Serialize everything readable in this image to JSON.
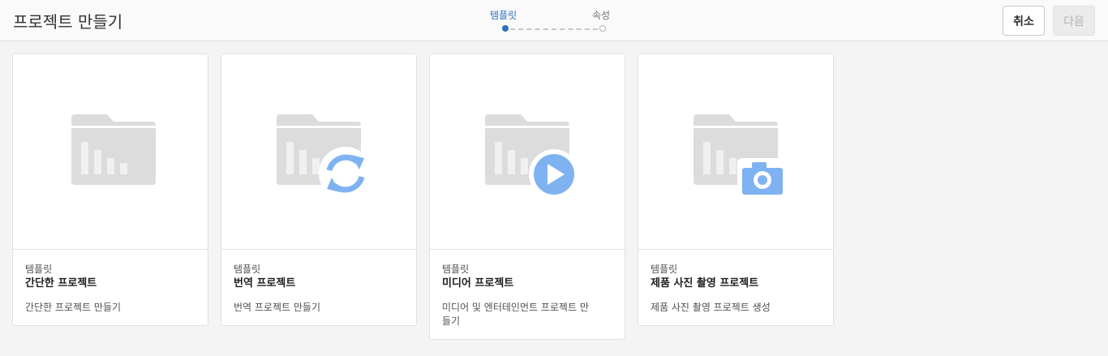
{
  "header": {
    "title": "프로젝트 만들기",
    "steps": [
      {
        "label": "템플릿",
        "active": true
      },
      {
        "label": "속성",
        "active": false
      }
    ],
    "cancel_label": "취소",
    "next_label": "다음"
  },
  "cards": [
    {
      "kicker": "템플릿",
      "title": "간단한 프로젝트",
      "description": "간단한 프로젝트 만들기",
      "badge_icon": "none"
    },
    {
      "kicker": "템플릿",
      "title": "번역 프로젝트",
      "description": "번역 프로젝트 만들기",
      "badge_icon": "sync-icon"
    },
    {
      "kicker": "템플릿",
      "title": "미디어 프로젝트",
      "description": "미디어 및 엔터테인먼트 프로젝트 만들기",
      "badge_icon": "play-icon"
    },
    {
      "kicker": "템플릿",
      "title": "제품 사진 촬영 프로젝트",
      "description": "제품 사진 촬영 프로젝트 생성",
      "badge_icon": "camera-icon"
    }
  ],
  "colors": {
    "accent": "#2c6fbf",
    "badge": "#7fb2f0",
    "folder": "#dcdcdc"
  }
}
